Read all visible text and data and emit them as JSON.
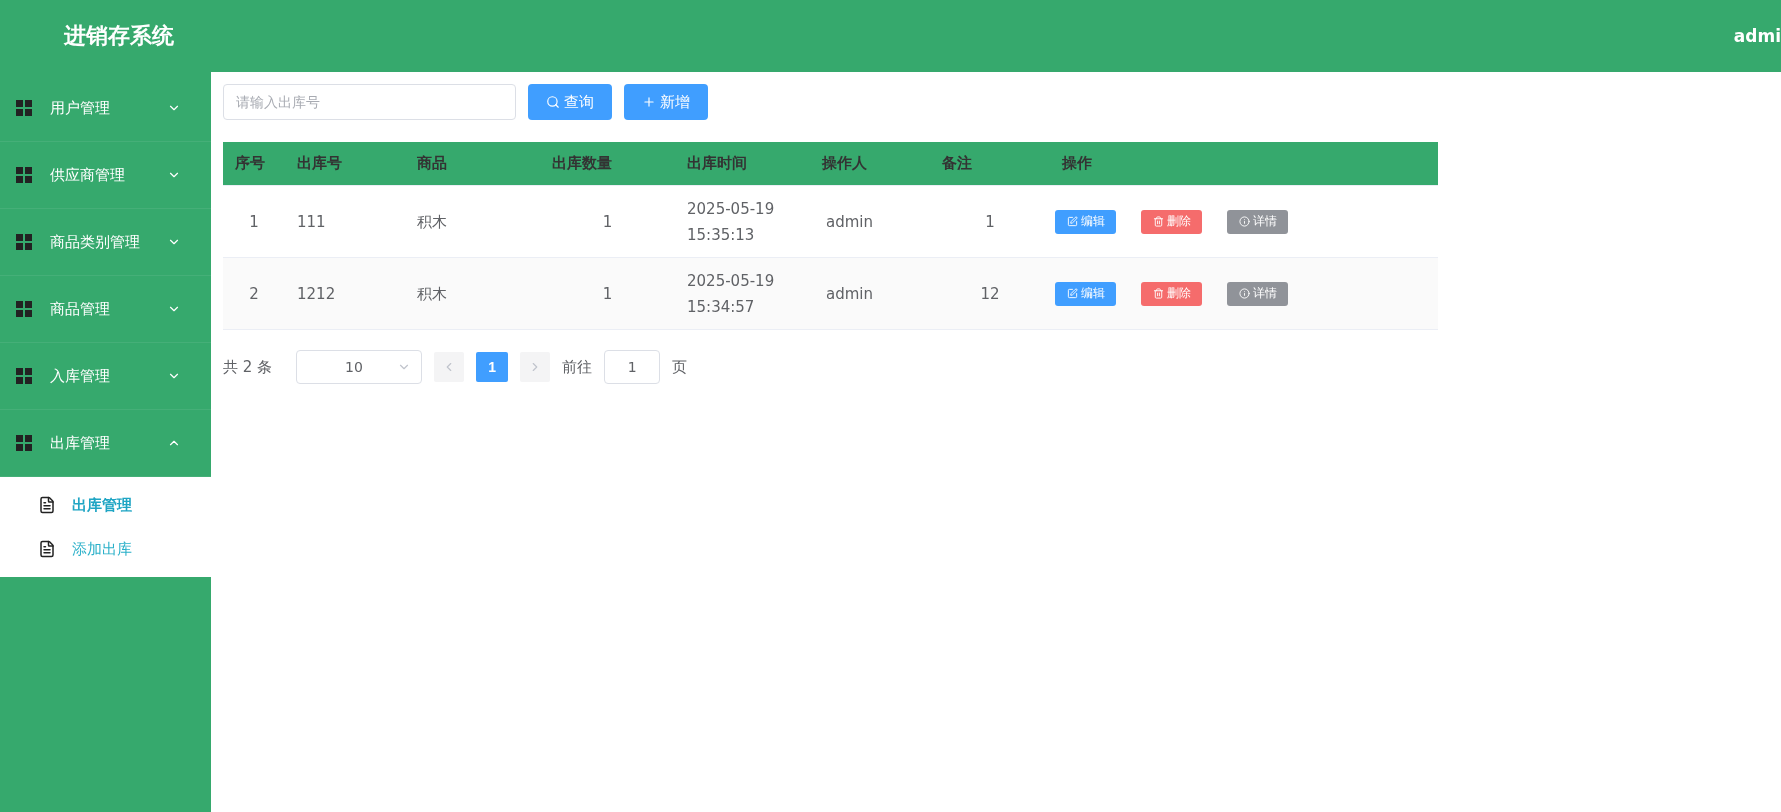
{
  "header": {
    "title": "进销存系统",
    "user": "admi"
  },
  "sidebar": {
    "items": [
      {
        "label": "用户管理",
        "expanded": false
      },
      {
        "label": "供应商管理",
        "expanded": false
      },
      {
        "label": "商品类别管理",
        "expanded": false
      },
      {
        "label": "商品管理",
        "expanded": false
      },
      {
        "label": "入库管理",
        "expanded": false
      },
      {
        "label": "出库管理",
        "expanded": true,
        "children": [
          {
            "label": "出库管理",
            "selected": true
          },
          {
            "label": "添加出库",
            "selected": false
          }
        ]
      }
    ]
  },
  "toolbar": {
    "search": {
      "placeholder": "请输入出库号"
    },
    "buttons": [
      {
        "kind": "search",
        "label": "查询"
      },
      {
        "kind": "add",
        "label": "新增"
      }
    ]
  },
  "table": {
    "columns": [
      "序号",
      "出库号",
      "商品",
      "出库数量",
      "出库时间",
      "操作人",
      "备注",
      "操作"
    ],
    "rows": [
      {
        "cells": [
          "1",
          "111",
          "积木",
          "1",
          "2025-05-19 15:35:13",
          "admin",
          "1"
        ],
        "actions": [
          {
            "kind": "edit",
            "label": "编辑"
          },
          {
            "kind": "delete",
            "label": "删除"
          },
          {
            "kind": "info",
            "label": "详情"
          }
        ]
      },
      {
        "cells": [
          "2",
          "1212",
          "积木",
          "1",
          "2025-05-19 15:34:57",
          "admin",
          "12"
        ],
        "actions": [
          {
            "kind": "edit",
            "label": "编辑"
          },
          {
            "kind": "delete",
            "label": "删除"
          },
          {
            "kind": "info",
            "label": "详情"
          }
        ]
      }
    ]
  },
  "pagination": {
    "total": "共 2 条",
    "page_size": "10",
    "pages": [
      {
        "label": "1",
        "selected": true
      }
    ],
    "goto_label": "前往",
    "goto_value": "1",
    "goto_suffix": "页"
  }
}
